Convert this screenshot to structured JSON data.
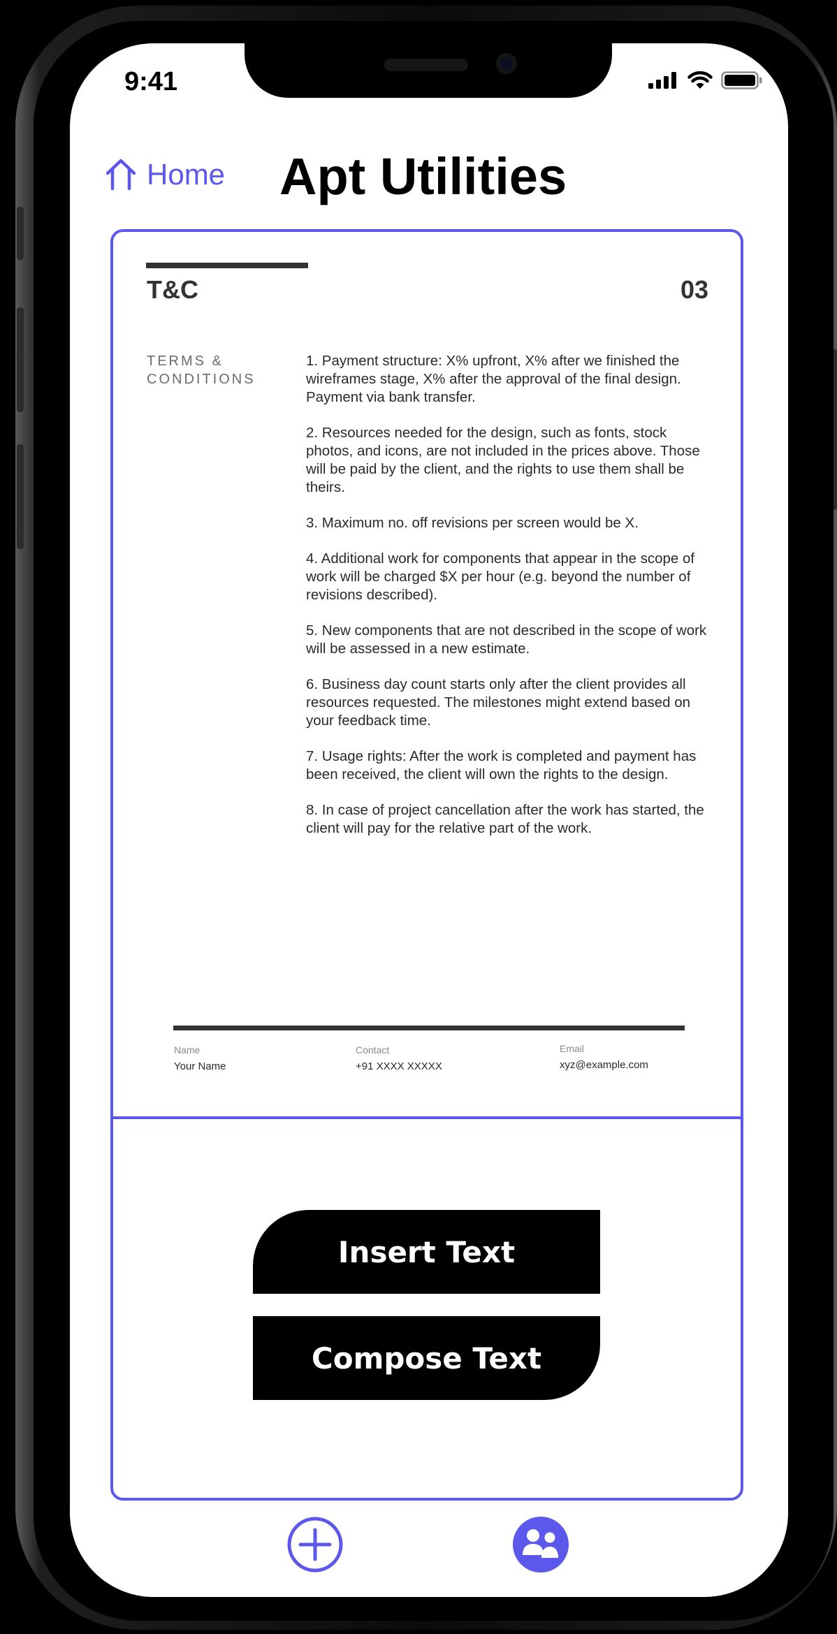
{
  "status_bar": {
    "time": "9:41"
  },
  "header": {
    "home_label": "Home",
    "title": "Apt Utilities"
  },
  "document": {
    "heading": "T&C",
    "page_number": "03",
    "side_label": "TERMS & CONDITIONS",
    "terms": [
      "1. Payment structure: X% upfront, X% after we finished the wireframes stage, X% after the approval of the final design. Payment via bank transfer.",
      "2. Resources needed for the design, such as fonts, stock photos, and icons, are not included in the prices above. Those will be paid by the client, and the rights to use them shall be theirs.",
      "3. Maximum no. off revisions per screen would be X.",
      "4. Additional work for components that appear in the scope of work will be charged $X per hour (e.g. beyond the number of revisions described).",
      "5. New components that are not described in the scope of work will be assessed in a new estimate.",
      "6. Business day count starts only after the client provides all resources requested. The milestones might extend based on your feedback time.",
      "7. Usage rights: After the work is completed and payment has been received, the client will own the rights to the design.",
      "8. In case of project cancellation after the work has started, the client will pay for the relative part of the work."
    ],
    "footer": {
      "name_label": "Name",
      "name_value": "Your Name",
      "contact_label": "Contact",
      "contact_value": "+91 XXXX XXXXX",
      "email_label": "Email",
      "email_value": "xyz@example.com"
    }
  },
  "actions": {
    "insert_label": "Insert Text",
    "compose_label": "Compose Text"
  },
  "tab_bar": {
    "icons": [
      "add-circle-icon",
      "people-icon"
    ]
  },
  "colors": {
    "accent": "#5B58EB",
    "text_dark": "#333333",
    "button_bg": "#000000"
  }
}
